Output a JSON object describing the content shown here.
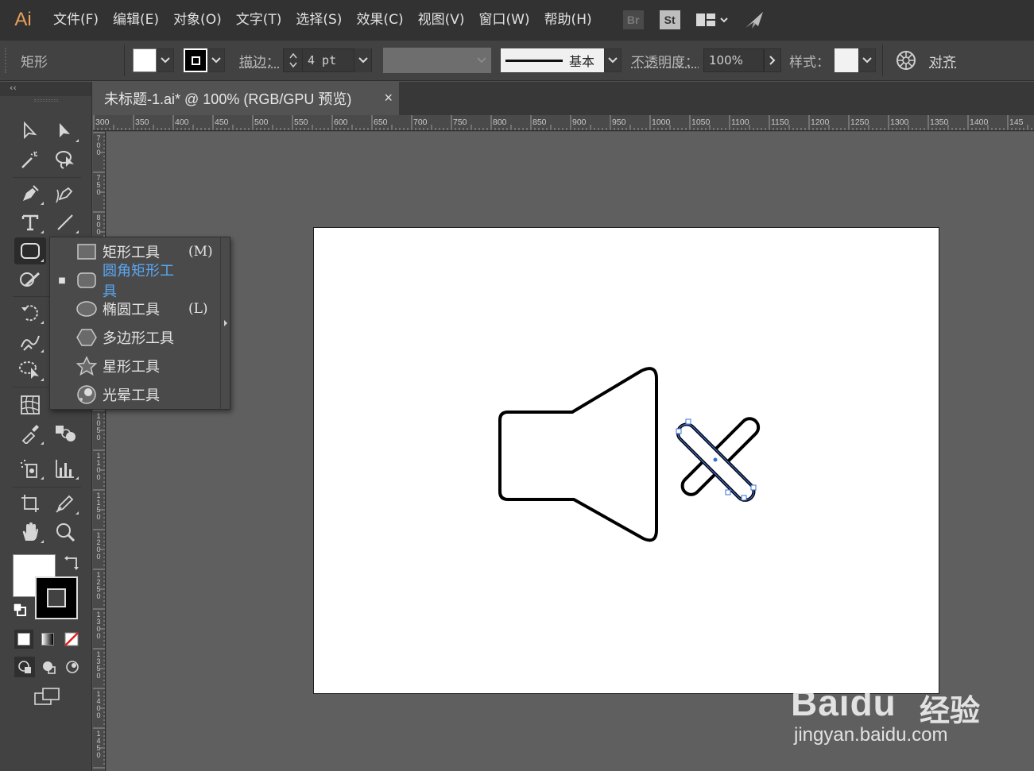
{
  "app": {
    "logo": "Ai"
  },
  "menu": [
    "文件(F)",
    "编辑(E)",
    "对象(O)",
    "文字(T)",
    "选择(S)",
    "效果(C)",
    "视图(V)",
    "窗口(W)",
    "帮助(H)"
  ],
  "menu_badges": {
    "bridge": "Br",
    "stock": "St"
  },
  "control_bar": {
    "selection_label": "矩形",
    "stroke_label": "描边：",
    "stroke_value": "4 pt",
    "profile_label": "基本",
    "opacity_label": "不透明度：",
    "opacity_value": "100%",
    "style_label": "样式：",
    "align_label": "对齐"
  },
  "toolbar": {
    "collapse_glyph": "‹‹"
  },
  "document_tab": {
    "title": "未标题-1.ai* @ 100% (RGB/GPU 预览)",
    "close": "×"
  },
  "ruler_h": [
    "300",
    "350",
    "400",
    "450",
    "500",
    "550",
    "600",
    "650",
    "700",
    "750",
    "800",
    "850",
    "900",
    "950",
    "1000",
    "1050",
    "1100",
    "1150",
    "1200",
    "1250",
    "1300",
    "1350",
    "1400",
    "145"
  ],
  "ruler_v": [
    "700",
    "750",
    "800",
    "850",
    "900",
    "950",
    "1000",
    "1050",
    "1100",
    "1150",
    "1200",
    "1250",
    "1300",
    "1350",
    "1400",
    "1450"
  ],
  "flyout": [
    {
      "label": "矩形工具",
      "key": "(M)",
      "icon": "rectangle-icon",
      "selected": false
    },
    {
      "label": "圆角矩形工具",
      "key": "",
      "icon": "rounded-rectangle-icon",
      "selected": true
    },
    {
      "label": "椭圆工具",
      "key": "(L)",
      "icon": "ellipse-icon",
      "selected": false
    },
    {
      "label": "多边形工具",
      "key": "",
      "icon": "polygon-icon",
      "selected": false
    },
    {
      "label": "星形工具",
      "key": "",
      "icon": "star-icon",
      "selected": false
    },
    {
      "label": "光晕工具",
      "key": "",
      "icon": "flare-icon",
      "selected": false
    }
  ],
  "flyout_bullet": "■",
  "watermark": {
    "brand": "Baidu",
    "brand_cn": "经验",
    "url": "jingyan.baidu.com"
  },
  "colors": {
    "accent": "#5aa6f0",
    "selection": "#3b6fd8",
    "logo": "#e8a05a"
  }
}
